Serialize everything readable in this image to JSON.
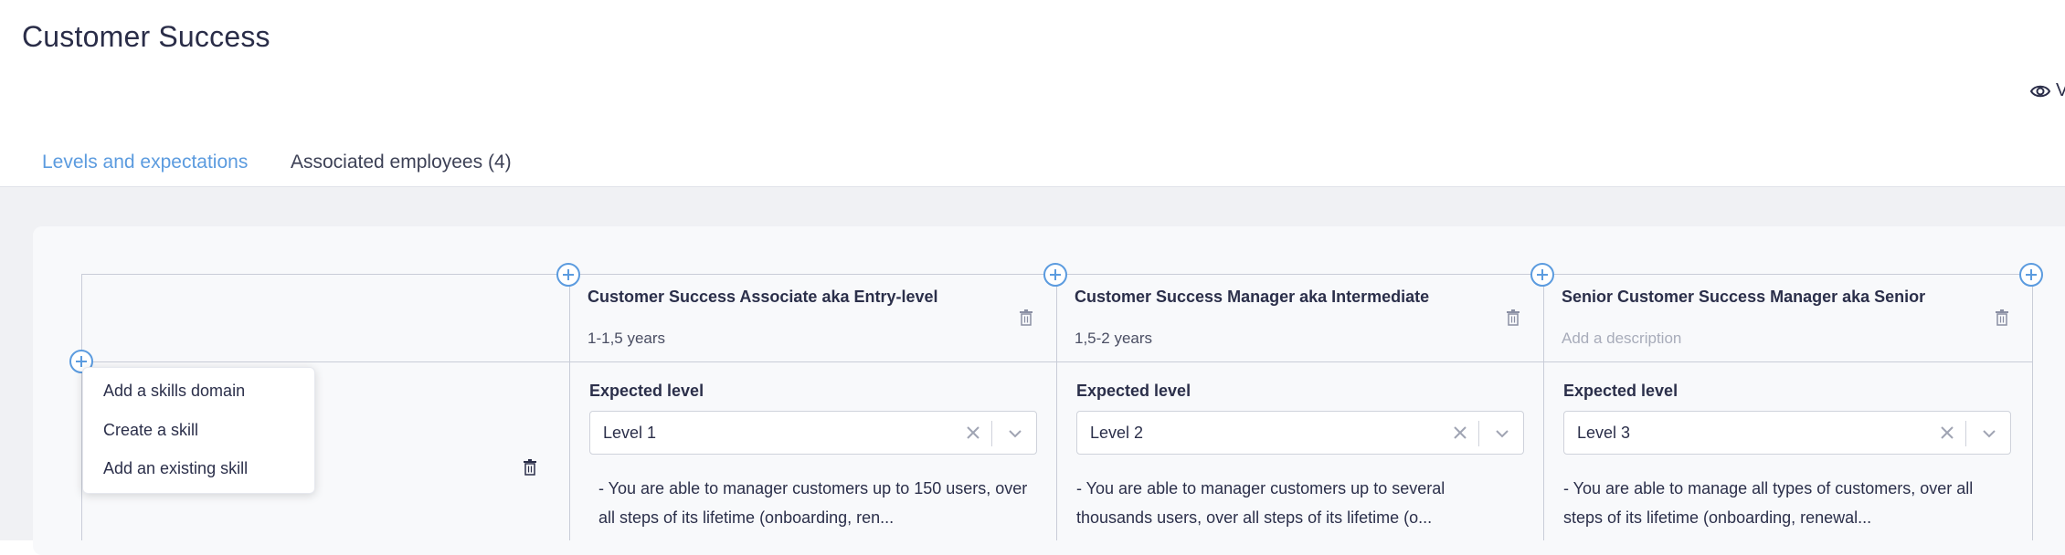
{
  "header": {
    "title": "Customer Success",
    "view_label": "V"
  },
  "tabs": [
    {
      "label": "Levels and expectations",
      "active": true
    },
    {
      "label": "Associated employees (4)",
      "active": false
    }
  ],
  "columns": [
    {
      "title": "Customer Success Associate aka Entry-level",
      "description": "1-1,5 years",
      "expected_label": "Expected level",
      "level": "Level 1",
      "text_line1": "- You are able to manager customers up to 150 users, over",
      "text_line2": "all steps of its lifetime (onboarding, ren..."
    },
    {
      "title": "Customer Success Manager aka Intermediate",
      "description": "1,5-2 years",
      "expected_label": "Expected level",
      "level": "Level 2",
      "text_line1": "- You are able to manager customers up to several",
      "text_line2": "thousands users, over all steps of its lifetime (o..."
    },
    {
      "title": "Senior Customer Success Manager aka Senior",
      "description": "Add a description",
      "expected_label": "Expected level",
      "level": "Level 3",
      "text_line1": "- You are able to manage all types of customers, over all",
      "text_line2": "steps of its lifetime (onboarding, renewal..."
    }
  ],
  "menu": {
    "items": [
      "Add a skills domain",
      "Create a skill",
      "Add an existing skill"
    ]
  },
  "colors": {
    "accent": "#5b9bdf",
    "text": "#2b2f4a",
    "background": "#f0f1f4"
  },
  "icons": [
    "eye-icon",
    "add-icon",
    "trash-icon",
    "clear-icon",
    "chevron-down-icon"
  ]
}
